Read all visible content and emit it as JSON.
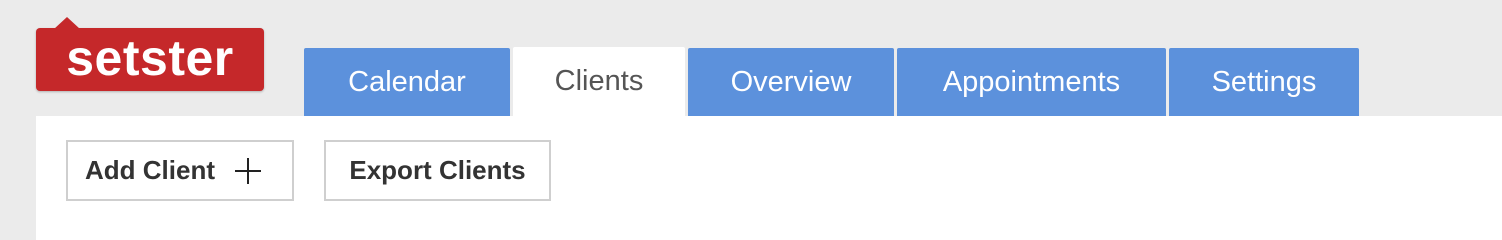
{
  "brand": {
    "logo_text": "setster",
    "color": "#c5282a"
  },
  "nav": {
    "accent_color": "#5c91dc",
    "active_tab": "Clients",
    "tabs": [
      {
        "label": "Calendar"
      },
      {
        "label": "Clients"
      },
      {
        "label": "Overview"
      },
      {
        "label": "Appointments"
      },
      {
        "label": "Settings"
      }
    ]
  },
  "toolbar": {
    "add_client_label": "Add Client",
    "add_client_icon": "plus-icon",
    "export_clients_label": "Export Clients"
  }
}
